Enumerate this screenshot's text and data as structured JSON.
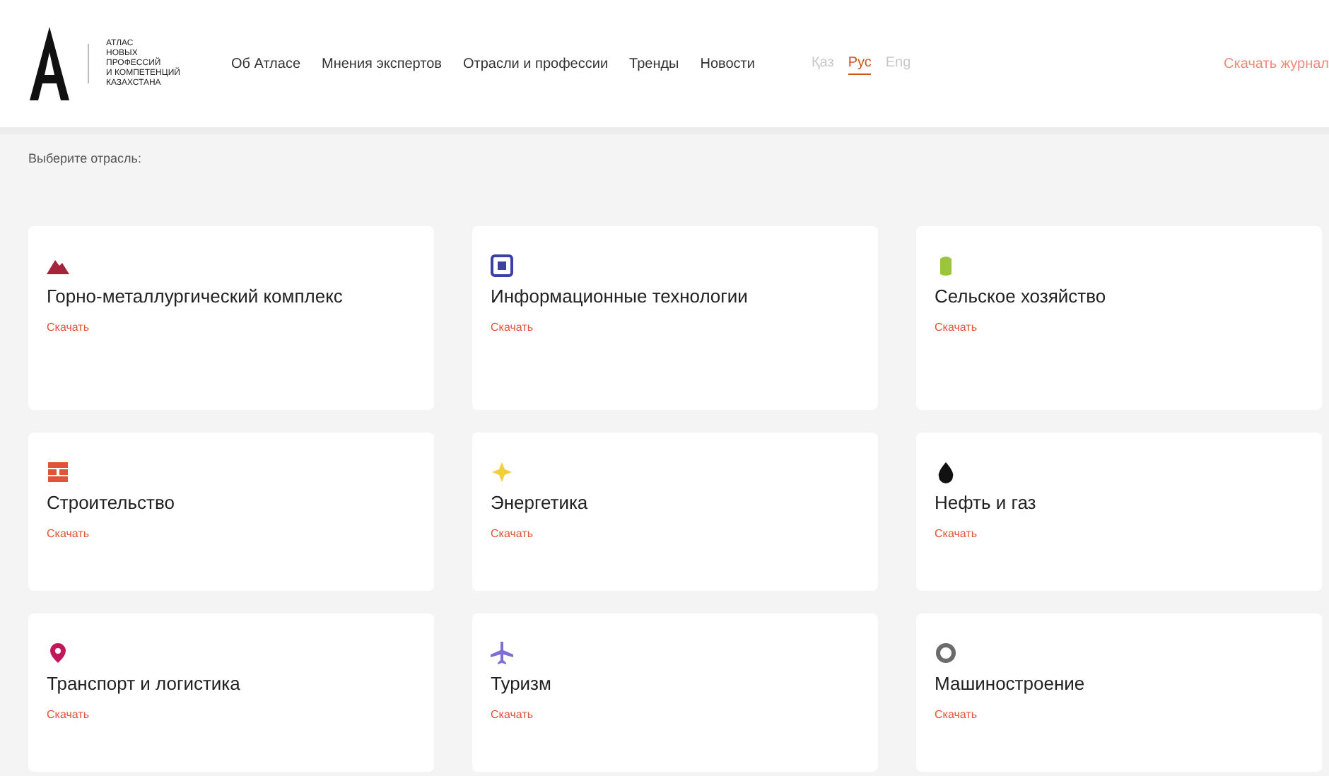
{
  "logo": {
    "lines": [
      "АТЛАС",
      "НОВЫХ",
      "ПРОФЕССИЙ",
      "И КОМПЕТЕНЦИЙ",
      "КАЗАХСТАНА"
    ]
  },
  "nav": [
    "Об Атласе",
    "Мнения экспертов",
    "Отрасли и профессии",
    "Тренды",
    "Новости"
  ],
  "languages": [
    {
      "label": "Қаз",
      "selected": false
    },
    {
      "label": "Рус",
      "selected": true
    },
    {
      "label": "Eng",
      "selected": false
    }
  ],
  "download_journal": "Скачать журнал",
  "prompt": "Выберите отрасль:",
  "industries": [
    {
      "kind": "mountain",
      "color": "#a3243b",
      "title": "Горно-металлургический комплекс",
      "link": "Скачать"
    },
    {
      "kind": "chip",
      "color": "#3b3fa8",
      "title": "Информационные технологии",
      "link": "Скачать"
    },
    {
      "kind": "plant",
      "color": "#9bc53d",
      "title": "Сельское хозяйство",
      "link": "Скачать"
    },
    {
      "kind": "bricks",
      "color": "#e0553a",
      "title": "Строительство",
      "link": "Скачать"
    },
    {
      "kind": "sun",
      "color": "#f2cf3a",
      "title": "Энергетика",
      "link": "Скачать"
    },
    {
      "kind": "drop",
      "color": "#111111",
      "title": "Нефть и газ",
      "link": "Скачать"
    },
    {
      "kind": "pin",
      "color": "#c2185b",
      "title": "Транспорт и логистика",
      "link": "Скачать"
    },
    {
      "kind": "plane",
      "color": "#7e6fd6",
      "title": "Туризм",
      "link": "Скачать"
    },
    {
      "kind": "gear",
      "color": "#6b6b6b",
      "title": "Машиностроение",
      "link": "Скачать"
    }
  ]
}
